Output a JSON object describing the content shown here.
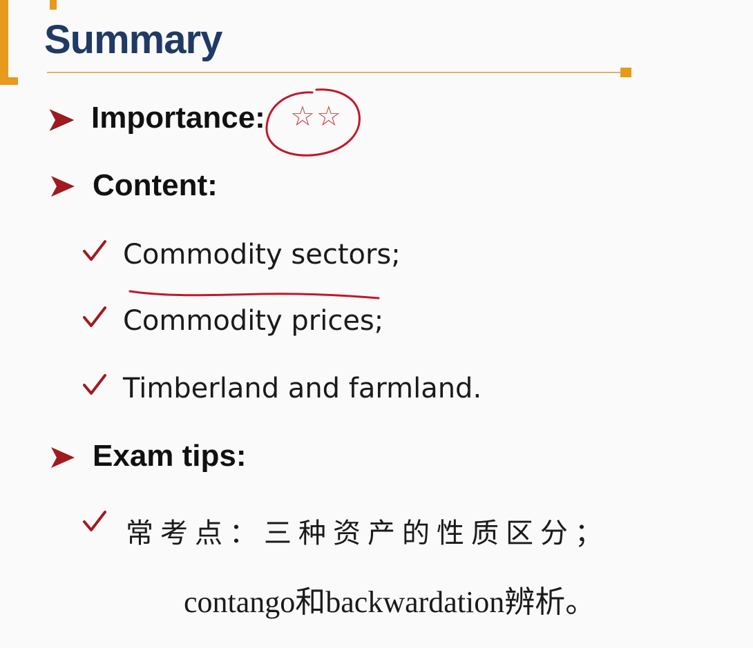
{
  "title": "Summary",
  "importance": {
    "label": "Importance:",
    "stars": "☆☆",
    "rating": 2
  },
  "content": {
    "label": "Content:",
    "items": [
      "Commodity sectors;",
      "Commodity prices;",
      "Timberland and farmland."
    ]
  },
  "exam_tips": {
    "label": "Exam tips:",
    "line1": "常考点：三种资产的性质区分；",
    "line2": "contango和backwardation辨析。"
  },
  "colors": {
    "accent": "#e89a1c",
    "title": "#1f3a64",
    "marker": "#a11a1f",
    "ink": "#c0182a"
  }
}
